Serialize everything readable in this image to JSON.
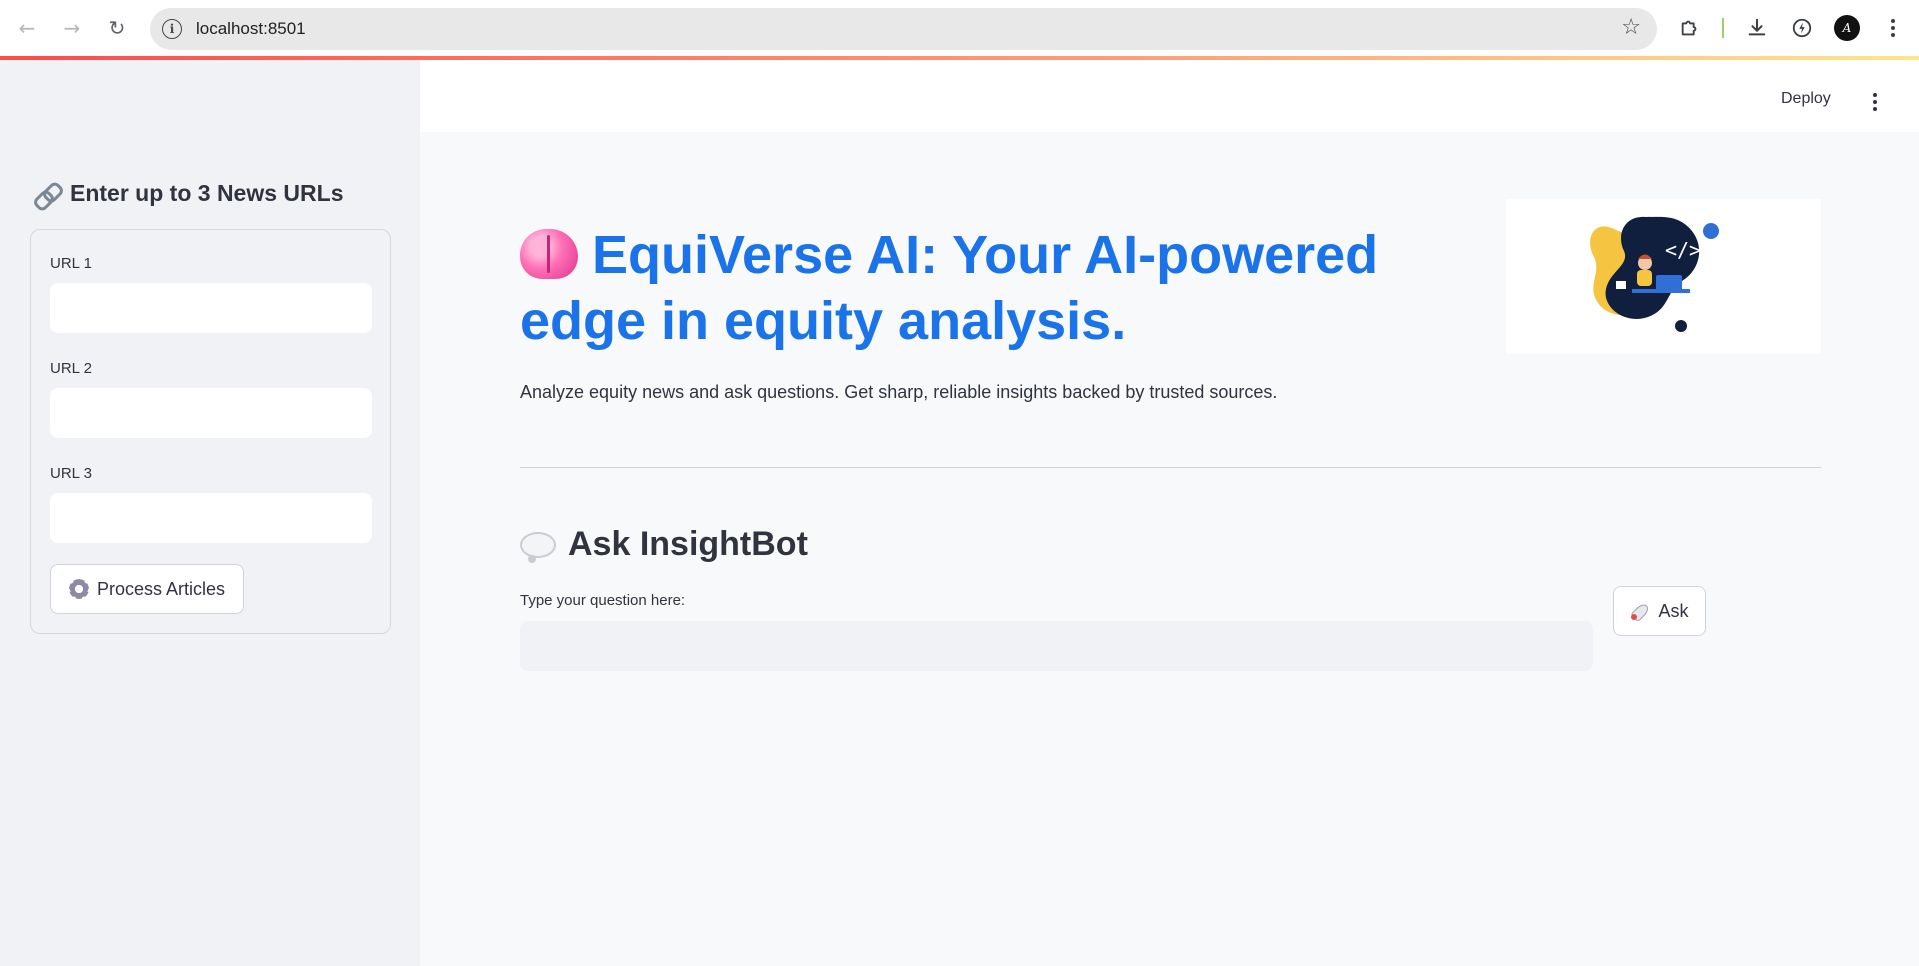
{
  "browser": {
    "url": "localhost:8501",
    "back_icon": "arrow-left",
    "forward_icon": "arrow-right",
    "reload_icon": "reload",
    "site_info_icon": "info",
    "bookmark_icon": "star",
    "extensions_icon": "puzzle",
    "downloads_icon": "download",
    "performance_icon": "lightning",
    "profile_initial": "A",
    "menu_icon": "vertical-dots"
  },
  "sidebar": {
    "title": "Enter up to 3 News URLs",
    "title_icon": "link",
    "fields": [
      {
        "label": "URL 1",
        "value": "",
        "placeholder": ""
      },
      {
        "label": "URL 2",
        "value": "",
        "placeholder": ""
      },
      {
        "label": "URL 3",
        "value": "",
        "placeholder": ""
      }
    ],
    "process_button": {
      "label": "Process Articles",
      "icon": "gear"
    }
  },
  "header": {
    "deploy_label": "Deploy",
    "menu_icon": "vertical-dots"
  },
  "main": {
    "title": "EquiVerse AI: Your AI-powered edge in equity analysis.",
    "title_icon": "brain",
    "subtitle": "Analyze equity news and ask questions. Get sharp, reliable insights backed by trusted sources.",
    "illustration_code_text": "</>",
    "ask_section": {
      "title": "Ask InsightBot",
      "title_icon": "speech-balloon",
      "question_label": "Type your question here:",
      "question_value": "",
      "question_placeholder": "",
      "ask_button": {
        "label": "Ask",
        "icon": "rocket"
      }
    }
  },
  "colors": {
    "accent_blue": "#1a73e8",
    "sidebar_bg": "#f0f2f6",
    "main_bg": "#f8f9fb",
    "text": "#31333f",
    "illustration_navy": "#0f1f3d",
    "illustration_yellow": "#f5c542",
    "illustration_blue": "#2f6fd6"
  }
}
